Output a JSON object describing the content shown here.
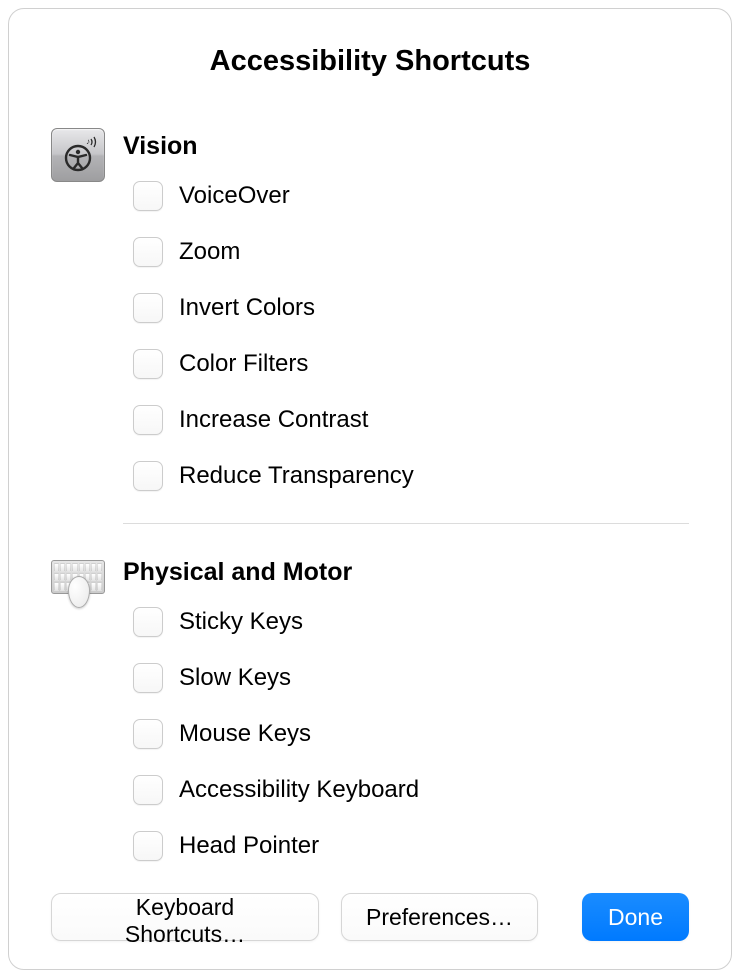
{
  "title": "Accessibility Shortcuts",
  "sections": [
    {
      "icon": "accessibility-icon",
      "title": "Vision",
      "options": [
        {
          "label": "VoiceOver",
          "checked": false
        },
        {
          "label": "Zoom",
          "checked": false
        },
        {
          "label": "Invert Colors",
          "checked": false
        },
        {
          "label": "Color Filters",
          "checked": false
        },
        {
          "label": "Increase Contrast",
          "checked": false
        },
        {
          "label": "Reduce Transparency",
          "checked": false
        }
      ]
    },
    {
      "icon": "keyboard-mouse-icon",
      "title": "Physical and Motor",
      "options": [
        {
          "label": "Sticky Keys",
          "checked": false
        },
        {
          "label": "Slow Keys",
          "checked": false
        },
        {
          "label": "Mouse Keys",
          "checked": false
        },
        {
          "label": "Accessibility Keyboard",
          "checked": false
        },
        {
          "label": "Head Pointer",
          "checked": false
        }
      ]
    }
  ],
  "buttons": {
    "keyboard_shortcuts": "Keyboard Shortcuts…",
    "preferences": "Preferences…",
    "done": "Done"
  },
  "colors": {
    "primary": "#007aff"
  }
}
